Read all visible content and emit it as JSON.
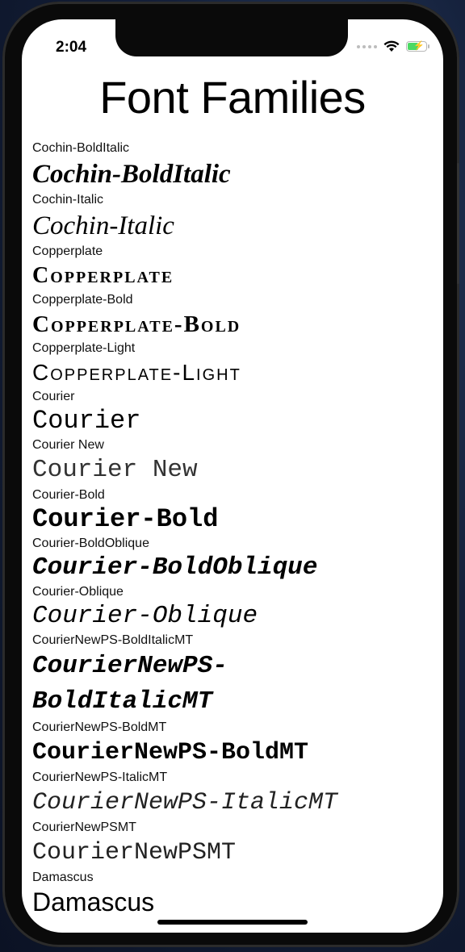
{
  "status": {
    "time": "2:04"
  },
  "title": "Font Families",
  "fonts": [
    {
      "label": "Cochin-BoldItalic",
      "sample": "Cochin-BoldItalic"
    },
    {
      "label": "Cochin-Italic",
      "sample": "Cochin-Italic"
    },
    {
      "label": "Copperplate",
      "sample": "Copperplate"
    },
    {
      "label": "Copperplate-Bold",
      "sample": "Copperplate-Bold"
    },
    {
      "label": "Copperplate-Light",
      "sample": "Copperplate-Light"
    },
    {
      "label": "Courier",
      "sample": "Courier"
    },
    {
      "label": "Courier New",
      "sample": "Courier New"
    },
    {
      "label": "Courier-Bold",
      "sample": "Courier-Bold"
    },
    {
      "label": "Courier-BoldOblique",
      "sample": "Courier-BoldOblique"
    },
    {
      "label": "Courier-Oblique",
      "sample": "Courier-Oblique"
    },
    {
      "label": "CourierNewPS-BoldItalicMT",
      "sample": "CourierNewPS-BoldItalicMT"
    },
    {
      "label": "CourierNewPS-BoldMT",
      "sample": "CourierNewPS-BoldMT"
    },
    {
      "label": "CourierNewPS-ItalicMT",
      "sample": "CourierNewPS-ItalicMT"
    },
    {
      "label": "CourierNewPSMT",
      "sample": "CourierNewPSMT"
    },
    {
      "label": "Damascus",
      "sample": "Damascus"
    }
  ],
  "icons": {
    "wifi": "wifi-icon",
    "battery": "battery-charging-icon",
    "signal": "cellular-signal-icon"
  },
  "colors": {
    "battery_fill": "#4cd964"
  }
}
